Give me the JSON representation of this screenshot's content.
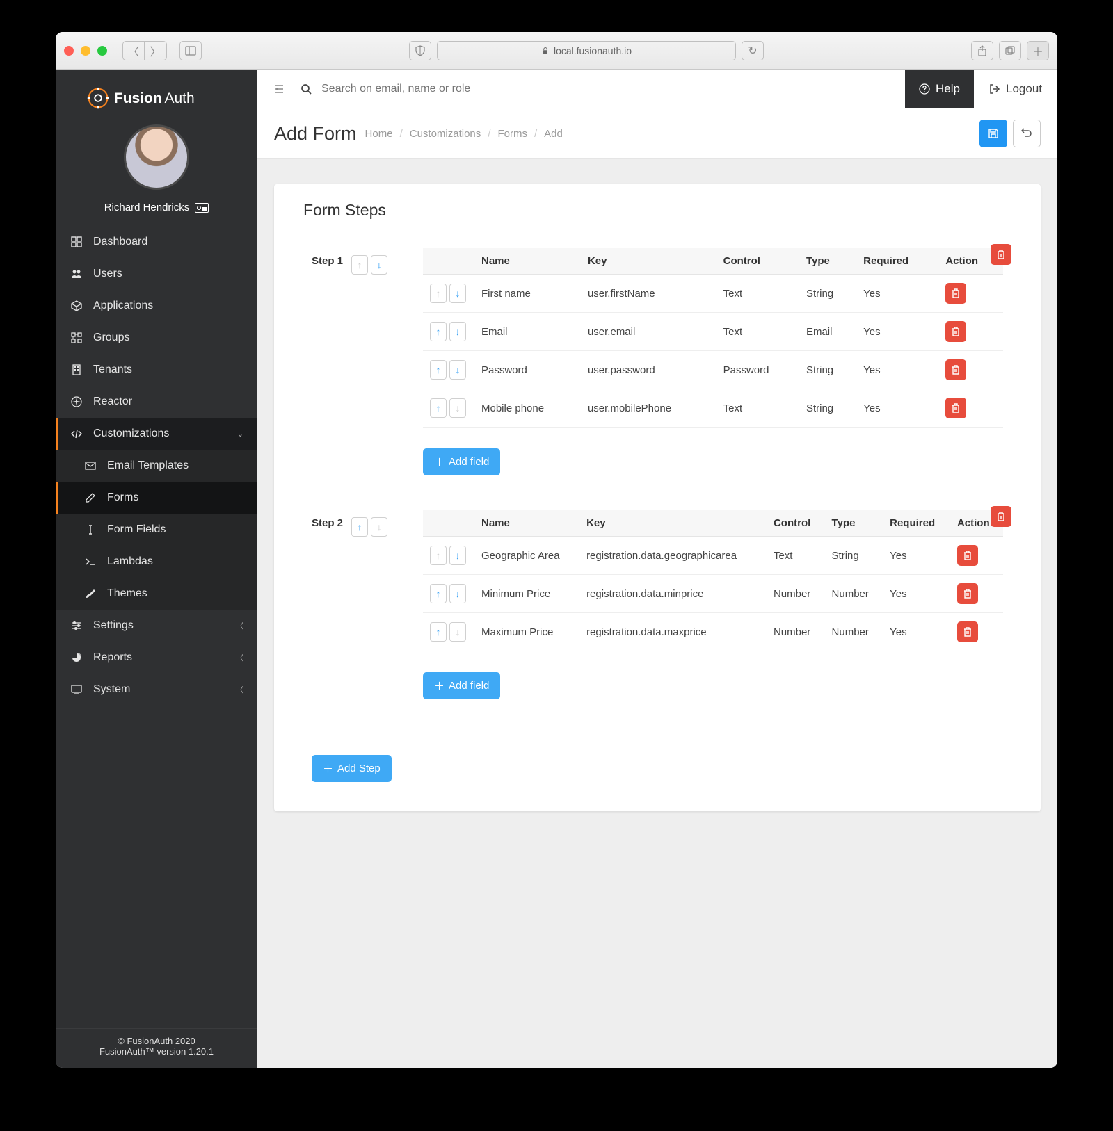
{
  "browser": {
    "url": "local.fusionauth.io"
  },
  "brand": {
    "name": "FusionAuth"
  },
  "user": {
    "name": "Richard Hendricks"
  },
  "sidebar": {
    "items": [
      {
        "label": "Dashboard"
      },
      {
        "label": "Users"
      },
      {
        "label": "Applications"
      },
      {
        "label": "Groups"
      },
      {
        "label": "Tenants"
      },
      {
        "label": "Reactor"
      },
      {
        "label": "Customizations"
      },
      {
        "label": "Settings"
      },
      {
        "label": "Reports"
      },
      {
        "label": "System"
      }
    ],
    "customizations": [
      {
        "label": "Email Templates"
      },
      {
        "label": "Forms"
      },
      {
        "label": "Form Fields"
      },
      {
        "label": "Lambdas"
      },
      {
        "label": "Themes"
      }
    ]
  },
  "search": {
    "placeholder": "Search on email, name or role"
  },
  "topbar": {
    "help": "Help",
    "logout": "Logout"
  },
  "title": "Add Form",
  "breadcrumbs": [
    "Home",
    "Customizations",
    "Forms",
    "Add"
  ],
  "section_title": "Form Steps",
  "table_headers": {
    "name": "Name",
    "key": "Key",
    "control": "Control",
    "type": "Type",
    "required": "Required",
    "action": "Action"
  },
  "steps": [
    {
      "label": "Step 1",
      "fields": [
        {
          "name": "First name",
          "key": "user.firstName",
          "control": "Text",
          "type": "String",
          "required": "Yes"
        },
        {
          "name": "Email",
          "key": "user.email",
          "control": "Text",
          "type": "Email",
          "required": "Yes"
        },
        {
          "name": "Password",
          "key": "user.password",
          "control": "Password",
          "type": "String",
          "required": "Yes"
        },
        {
          "name": "Mobile phone",
          "key": "user.mobilePhone",
          "control": "Text",
          "type": "String",
          "required": "Yes"
        }
      ]
    },
    {
      "label": "Step 2",
      "fields": [
        {
          "name": "Geographic Area",
          "key": "registration.data.geographicarea",
          "control": "Text",
          "type": "String",
          "required": "Yes"
        },
        {
          "name": "Minimum Price",
          "key": "registration.data.minprice",
          "control": "Number",
          "type": "Number",
          "required": "Yes"
        },
        {
          "name": "Maximum Price",
          "key": "registration.data.maxprice",
          "control": "Number",
          "type": "Number",
          "required": "Yes"
        }
      ]
    }
  ],
  "buttons": {
    "add_field": "Add field",
    "add_step": "Add Step"
  },
  "footer": {
    "copyright": "© FusionAuth 2020",
    "version": "FusionAuth™ version 1.20.1"
  }
}
